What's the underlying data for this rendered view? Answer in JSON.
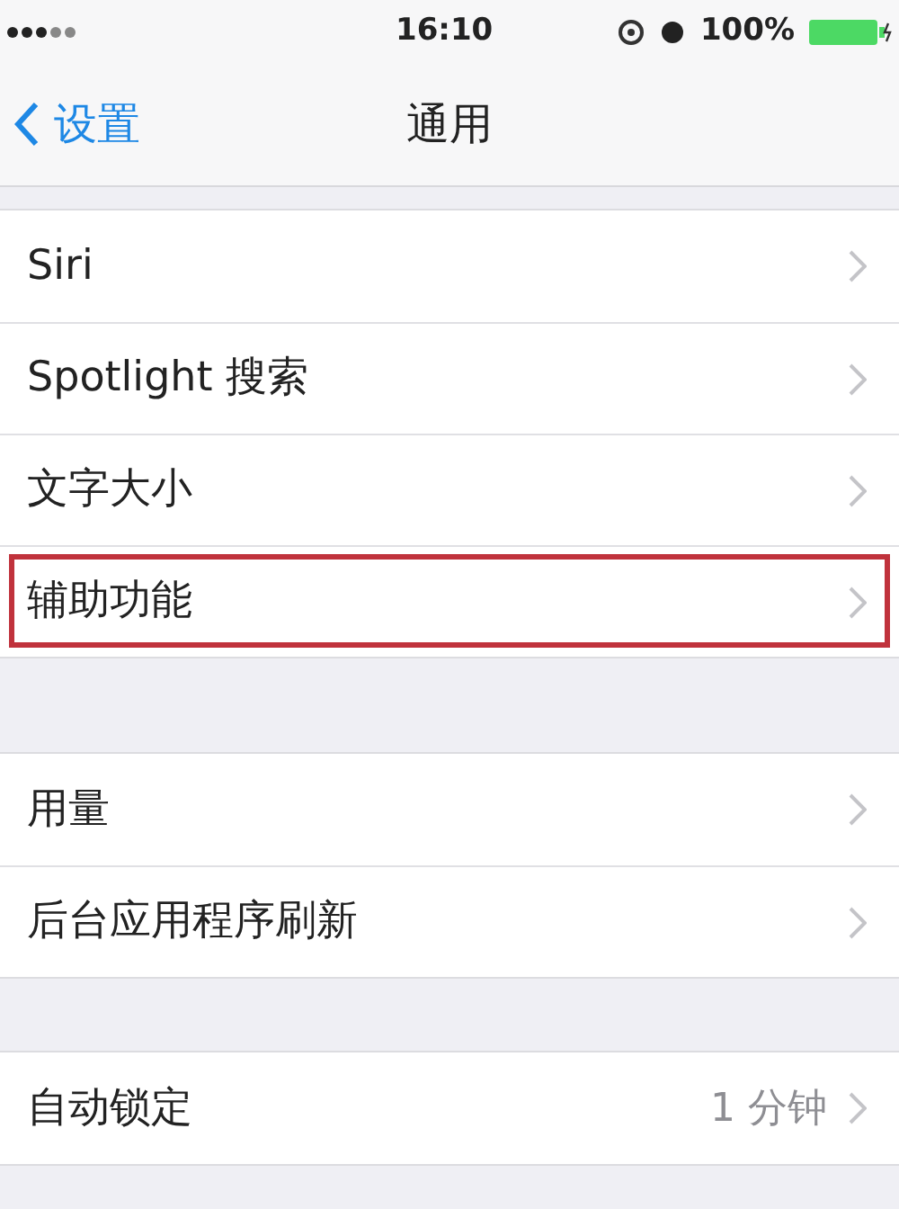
{
  "status_bar": {
    "time": "16:10",
    "battery": "100%"
  },
  "nav": {
    "back": "设置",
    "title": "通用"
  },
  "groups": [
    {
      "rows": [
        {
          "label": "Siri",
          "highlighted": false
        },
        {
          "label": "Spotlight 搜索",
          "highlighted": false
        },
        {
          "label": "文字大小",
          "highlighted": false
        },
        {
          "label": "辅助功能",
          "highlighted": true
        }
      ]
    },
    {
      "rows": [
        {
          "label": "用量",
          "highlighted": false
        },
        {
          "label": "后台应用程序刷新",
          "highlighted": false
        }
      ]
    },
    {
      "rows": [
        {
          "label": "自动锁定",
          "value": "1 分钟",
          "highlighted": false
        }
      ]
    }
  ]
}
